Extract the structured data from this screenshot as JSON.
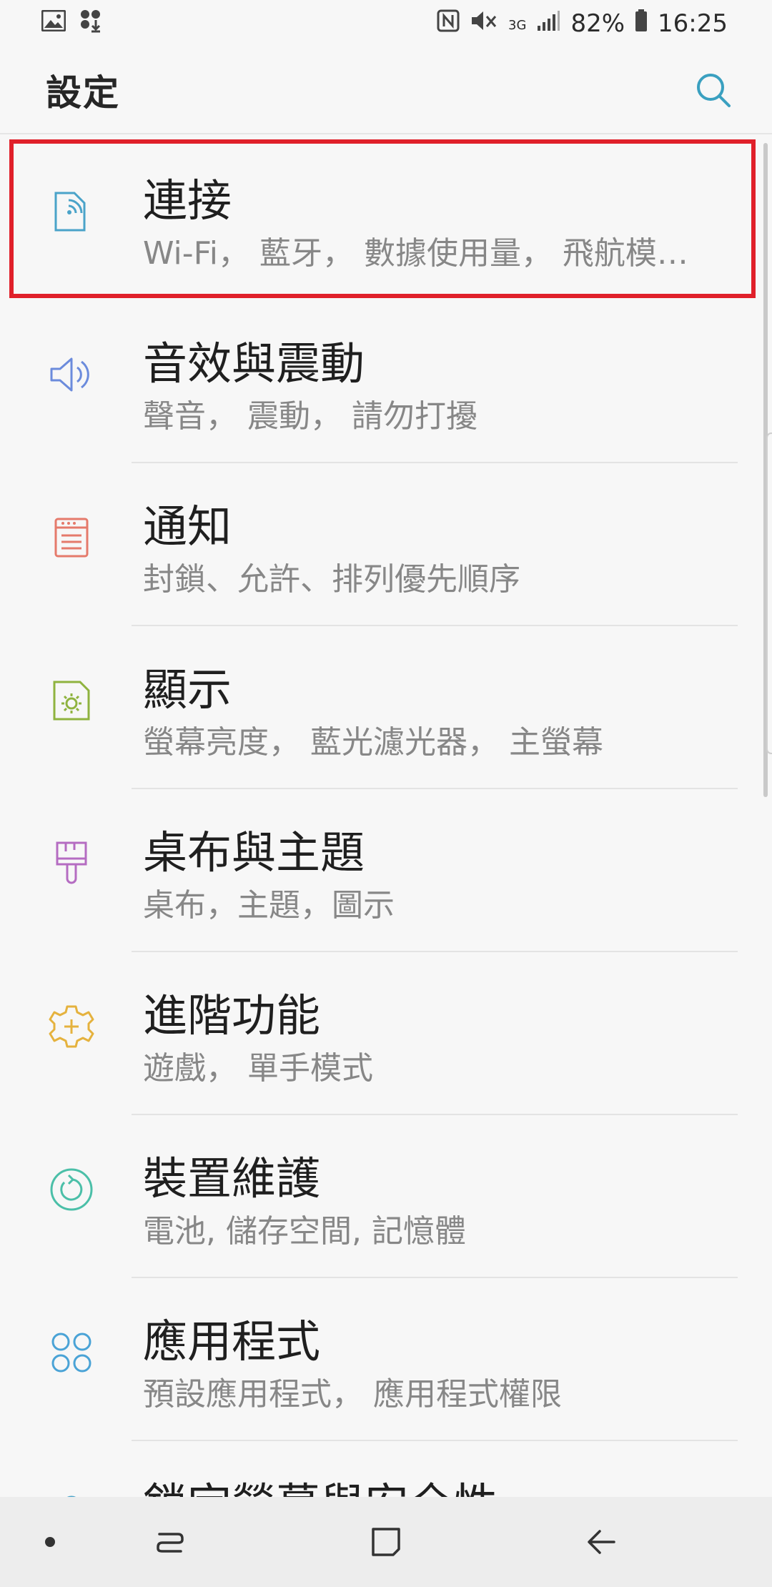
{
  "status_bar": {
    "battery": "82%",
    "time": "16:25",
    "network": "3G"
  },
  "header": {
    "title": "設定"
  },
  "items": [
    {
      "title": "連接",
      "subtitle": "Wi-Fi， 藍牙， 數據使用量， 飛航模…",
      "icon": "connection-icon",
      "color": "#4aa3c9"
    },
    {
      "title": "音效與震動",
      "subtitle": "聲音， 震動， 請勿打擾",
      "icon": "speaker-icon",
      "color": "#6b8bdc"
    },
    {
      "title": "通知",
      "subtitle": "封鎖、允許、排列優先順序",
      "icon": "notification-icon",
      "color": "#e57a6b"
    },
    {
      "title": "顯示",
      "subtitle": "螢幕亮度， 藍光濾光器， 主螢幕",
      "icon": "display-icon",
      "color": "#8fb33f"
    },
    {
      "title": "桌布與主題",
      "subtitle": "桌布，主題，圖示",
      "icon": "paintbrush-icon",
      "color": "#b56cc2"
    },
    {
      "title": "進階功能",
      "subtitle": "遊戲， 單手模式",
      "icon": "gear-plus-icon",
      "color": "#e5b23e"
    },
    {
      "title": "裝置維護",
      "subtitle": "電池, 儲存空間, 記憶體",
      "icon": "refresh-icon",
      "color": "#4bbfa8"
    },
    {
      "title": "應用程式",
      "subtitle": "預設應用程式， 應用程式權限",
      "icon": "apps-grid-icon",
      "color": "#4aa3d6"
    },
    {
      "title": "鎖定螢幕與安全性",
      "subtitle": "",
      "icon": "lock-icon",
      "color": "#4aa3c9"
    }
  ],
  "colors": {
    "highlight": "#e0202a",
    "accent": "#3aa0c0"
  }
}
